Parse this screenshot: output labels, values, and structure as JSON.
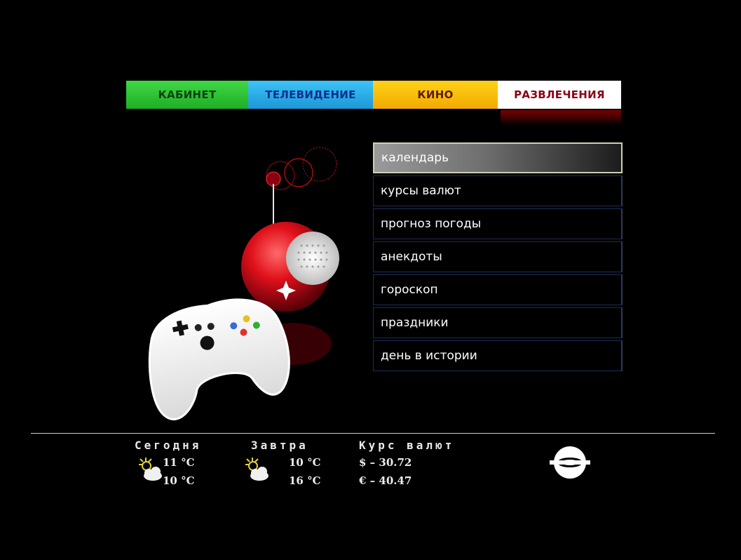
{
  "tabs": [
    {
      "label": "КАБИНЕТ",
      "color": "#2fc935"
    },
    {
      "label": "ТЕЛЕВИДЕНИЕ",
      "color": "#2bb0ea"
    },
    {
      "label": "КИНО",
      "color": "#f9be0a"
    },
    {
      "label": "РАЗВЛЕЧЕНИЯ",
      "color": "#ffffff",
      "active": true
    }
  ],
  "menu": {
    "items": [
      {
        "label": "календарь",
        "selected": true
      },
      {
        "label": "курсы валют"
      },
      {
        "label": "прогноз погоды"
      },
      {
        "label": "анекдоты"
      },
      {
        "label": "гороскоп"
      },
      {
        "label": "праздники"
      },
      {
        "label": "день в истории"
      }
    ]
  },
  "footer": {
    "today": {
      "label": "Сегодня",
      "temp_day": "11 °С",
      "temp_night": "10 °С",
      "icon": "partly-cloudy-icon"
    },
    "tomorrow": {
      "label": "Завтра",
      "temp_day": "10 °С",
      "temp_night": "16 °С",
      "icon": "partly-cloudy-icon"
    },
    "currency": {
      "label": "Курс валют",
      "usd": "$ – 30.72",
      "eur": "€ – 40.47"
    },
    "logo": "broadcaster-logo"
  },
  "colors": {
    "accent_red": "#d0101a",
    "selected_border": "#cfcfb0",
    "menu_border": "#1c2d54"
  }
}
